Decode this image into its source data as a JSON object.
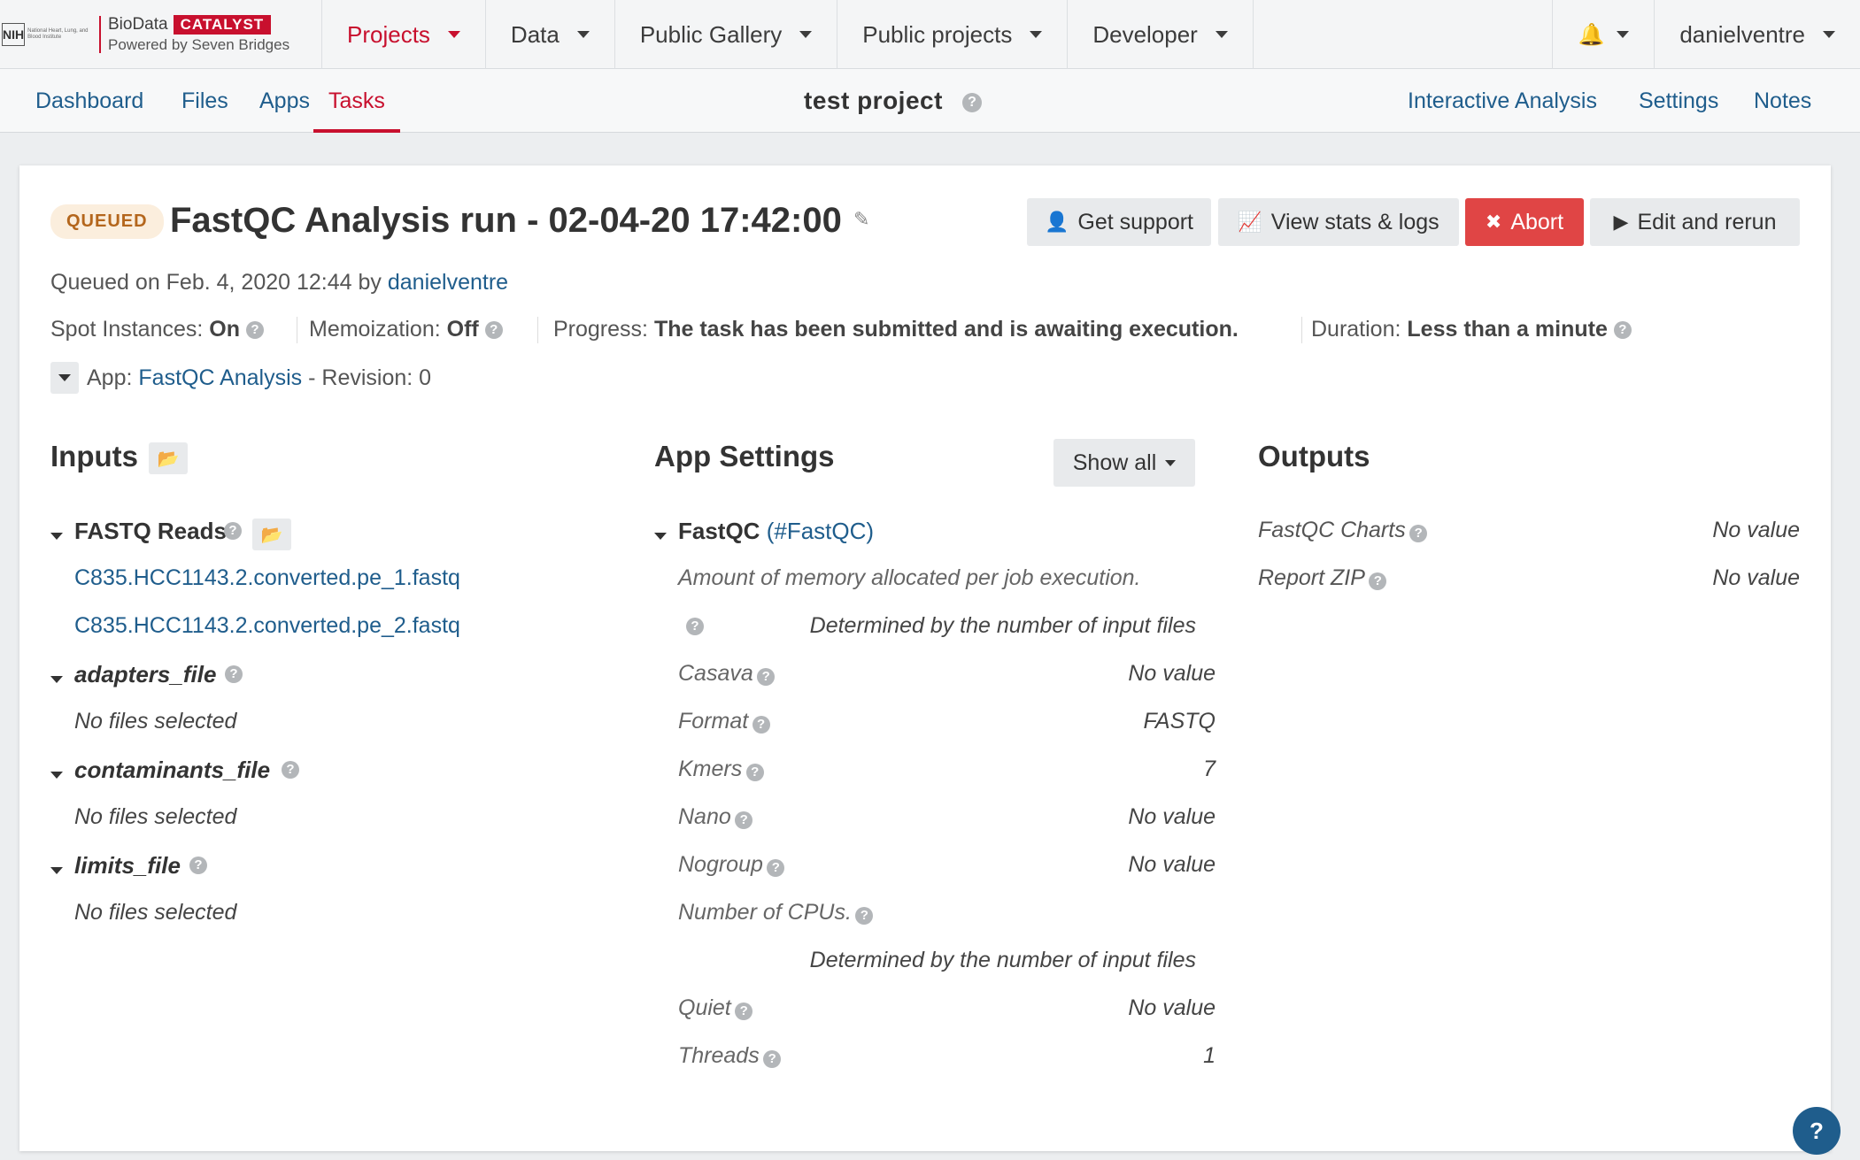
{
  "brand": {
    "nih_label": "NIH",
    "nih_small": "National Heart, Lung, and Blood Institute",
    "name": "BioData",
    "product": "CATALYST",
    "tagline": "Powered by Seven Bridges"
  },
  "topnav": {
    "items": [
      {
        "label": "Projects"
      },
      {
        "label": "Data"
      },
      {
        "label": "Public Gallery"
      },
      {
        "label": "Public projects"
      },
      {
        "label": "Developer"
      }
    ],
    "user": "danielventre"
  },
  "subnav": {
    "tabs": [
      {
        "label": "Dashboard"
      },
      {
        "label": "Files"
      },
      {
        "label": "Apps"
      },
      {
        "label": "Tasks"
      }
    ],
    "project_title": "test project",
    "right_links": [
      {
        "label": "Interactive Analysis"
      },
      {
        "label": "Settings"
      },
      {
        "label": "Notes"
      }
    ]
  },
  "task": {
    "status": "QUEUED",
    "title": "FastQC Analysis run - 02-04-20 17:42:00",
    "buttons": {
      "support": "Get support",
      "stats": "View stats & logs",
      "abort": "Abort",
      "rerun": "Edit and rerun"
    },
    "queued_prefix": "Queued on Feb. 4, 2020 12:44 by",
    "queued_user": "danielventre",
    "spot_label": "Spot Instances:",
    "spot_value": "On",
    "memo_label": "Memoization:",
    "memo_value": "Off",
    "progress_label": "Progress:",
    "progress_value": "The task has been submitted and is awaiting execution.",
    "duration_label": "Duration:",
    "duration_value": "Less than a minute",
    "app_label": "App:",
    "app_name": "FastQC Analysis",
    "revision": "- Revision: 0"
  },
  "inputs": {
    "heading": "Inputs",
    "fastq_label": "FASTQ Reads",
    "files": [
      "C835.HCC1143.2.converted.pe_1.fastq",
      "C835.HCC1143.2.converted.pe_2.fastq"
    ],
    "adapters_label": "adapters_file",
    "contaminants_label": "contaminants_file",
    "limits_label": "limits_file",
    "no_files": "No files selected"
  },
  "settings": {
    "heading": "App Settings",
    "show_all": "Show all",
    "tool_name": "FastQC",
    "tool_id": "(#FastQC)",
    "memory_label": "Amount of memory allocated per job execution.",
    "memory_value": "Determined by the number of input files",
    "rows": [
      {
        "label": "Casava",
        "value": "No value"
      },
      {
        "label": "Format",
        "value": "FASTQ"
      },
      {
        "label": "Kmers",
        "value": "7"
      },
      {
        "label": "Nano",
        "value": "No value"
      },
      {
        "label": "Nogroup",
        "value": "No value"
      }
    ],
    "cpus_label": "Number of CPUs.",
    "cpus_value": "Determined by the number of input files",
    "quiet_label": "Quiet",
    "quiet_value": "No value",
    "threads_label": "Threads",
    "threads_value": "1"
  },
  "outputs": {
    "heading": "Outputs",
    "rows": [
      {
        "label": "FastQC Charts",
        "value": "No value"
      },
      {
        "label": "Report ZIP",
        "value": "No value"
      }
    ]
  },
  "colors": {
    "brand_red": "#c8102e",
    "link_blue": "#1f5d8c",
    "abort_red": "#e04545",
    "queued_bg": "#fbeedd"
  },
  "icons": {
    "help": "?",
    "folder": "📂",
    "bell": "🔔",
    "user": "👤",
    "chart": "📈",
    "close": "✖",
    "play": "▶",
    "pencil": "✎"
  }
}
